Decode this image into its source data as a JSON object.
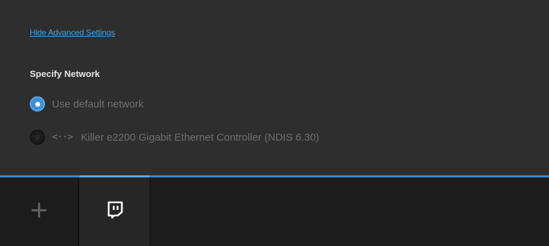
{
  "advanced": {
    "toggle_label": "Hide Advanced Settings"
  },
  "network": {
    "section_title": "Specify Network",
    "options": [
      {
        "label": "Use default network",
        "selected": true
      },
      {
        "icon": "<··>",
        "label": "Killer e2200 Gigabit Ethernet Controller (NDIS 6.30)",
        "selected": false
      }
    ]
  },
  "bottom_bar": {
    "add_symbol": "+",
    "tabs": [
      {
        "icon": "twitch-icon",
        "active": true
      }
    ]
  },
  "colors": {
    "accent": "#3a8bcf",
    "link": "#4a9fd8",
    "panel_bg": "#2e2e2e",
    "bar_bg": "#1c1c1c"
  }
}
